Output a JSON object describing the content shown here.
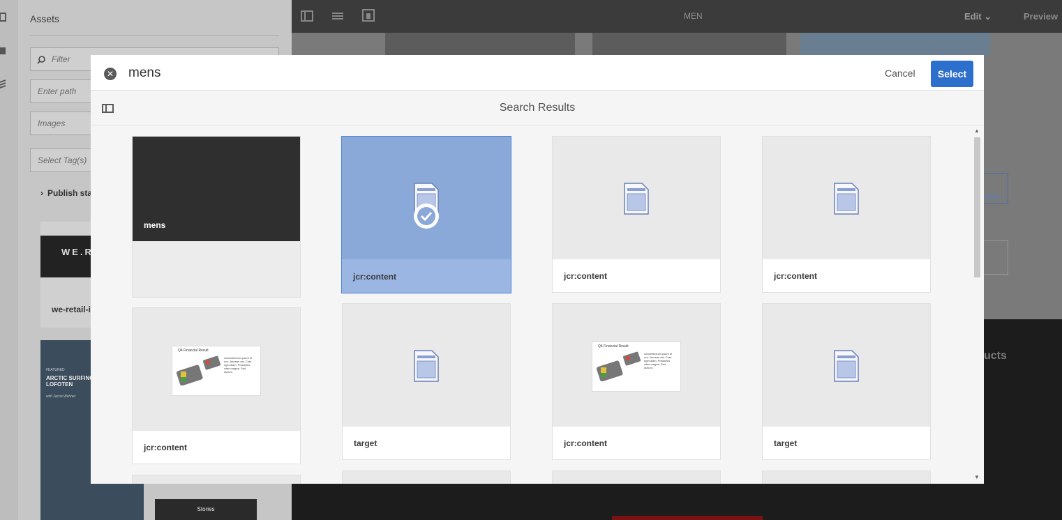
{
  "background": {
    "assets": {
      "title": "Assets",
      "filter_placeholder": "Filter",
      "path_placeholder": "Enter path",
      "type_placeholder": "Images",
      "tags_placeholder": "Select Tag(s)",
      "publish_label": "Publish sta",
      "card1_label": "we-retail-i",
      "card1_banner": "WE.R",
      "card2_tag": "FEATURED",
      "card2_title": "ARCTIC SURFING LOFOTEN",
      "card2_byline": "with Jacob Wehner",
      "card3_label": "Stories"
    },
    "topbar": {
      "page_title": "MEN",
      "edit_label": "Edit",
      "preview_label": "Preview"
    },
    "page": {
      "button_label": "Button",
      "products_fragment": "ucts"
    }
  },
  "modal": {
    "search_value": "mens",
    "cancel_label": "Cancel",
    "select_label": "Select",
    "results_title": "Search Results",
    "financial_thumb_title": "Q4 Financial Result",
    "financial_thumb_text": "condimentum ipsum et orci. Aenean est. Cras eget diam. Phasellus vitae magna. Sed dictum."
  },
  "results": [
    {
      "label": "mens",
      "kind": "folder"
    },
    {
      "label": "jcr:content",
      "kind": "doc",
      "selected": true
    },
    {
      "label": "jcr:content",
      "kind": "doc"
    },
    {
      "label": "jcr:content",
      "kind": "doc"
    },
    {
      "label": "jcr:content",
      "kind": "financial"
    },
    {
      "label": "target",
      "kind": "doc"
    },
    {
      "label": "jcr:content",
      "kind": "financial"
    },
    {
      "label": "target",
      "kind": "doc"
    }
  ],
  "colors": {
    "primary_button": "#2d6fcc",
    "selected_card": "#8aa8d8",
    "modal_background": "#f5f5f5"
  }
}
